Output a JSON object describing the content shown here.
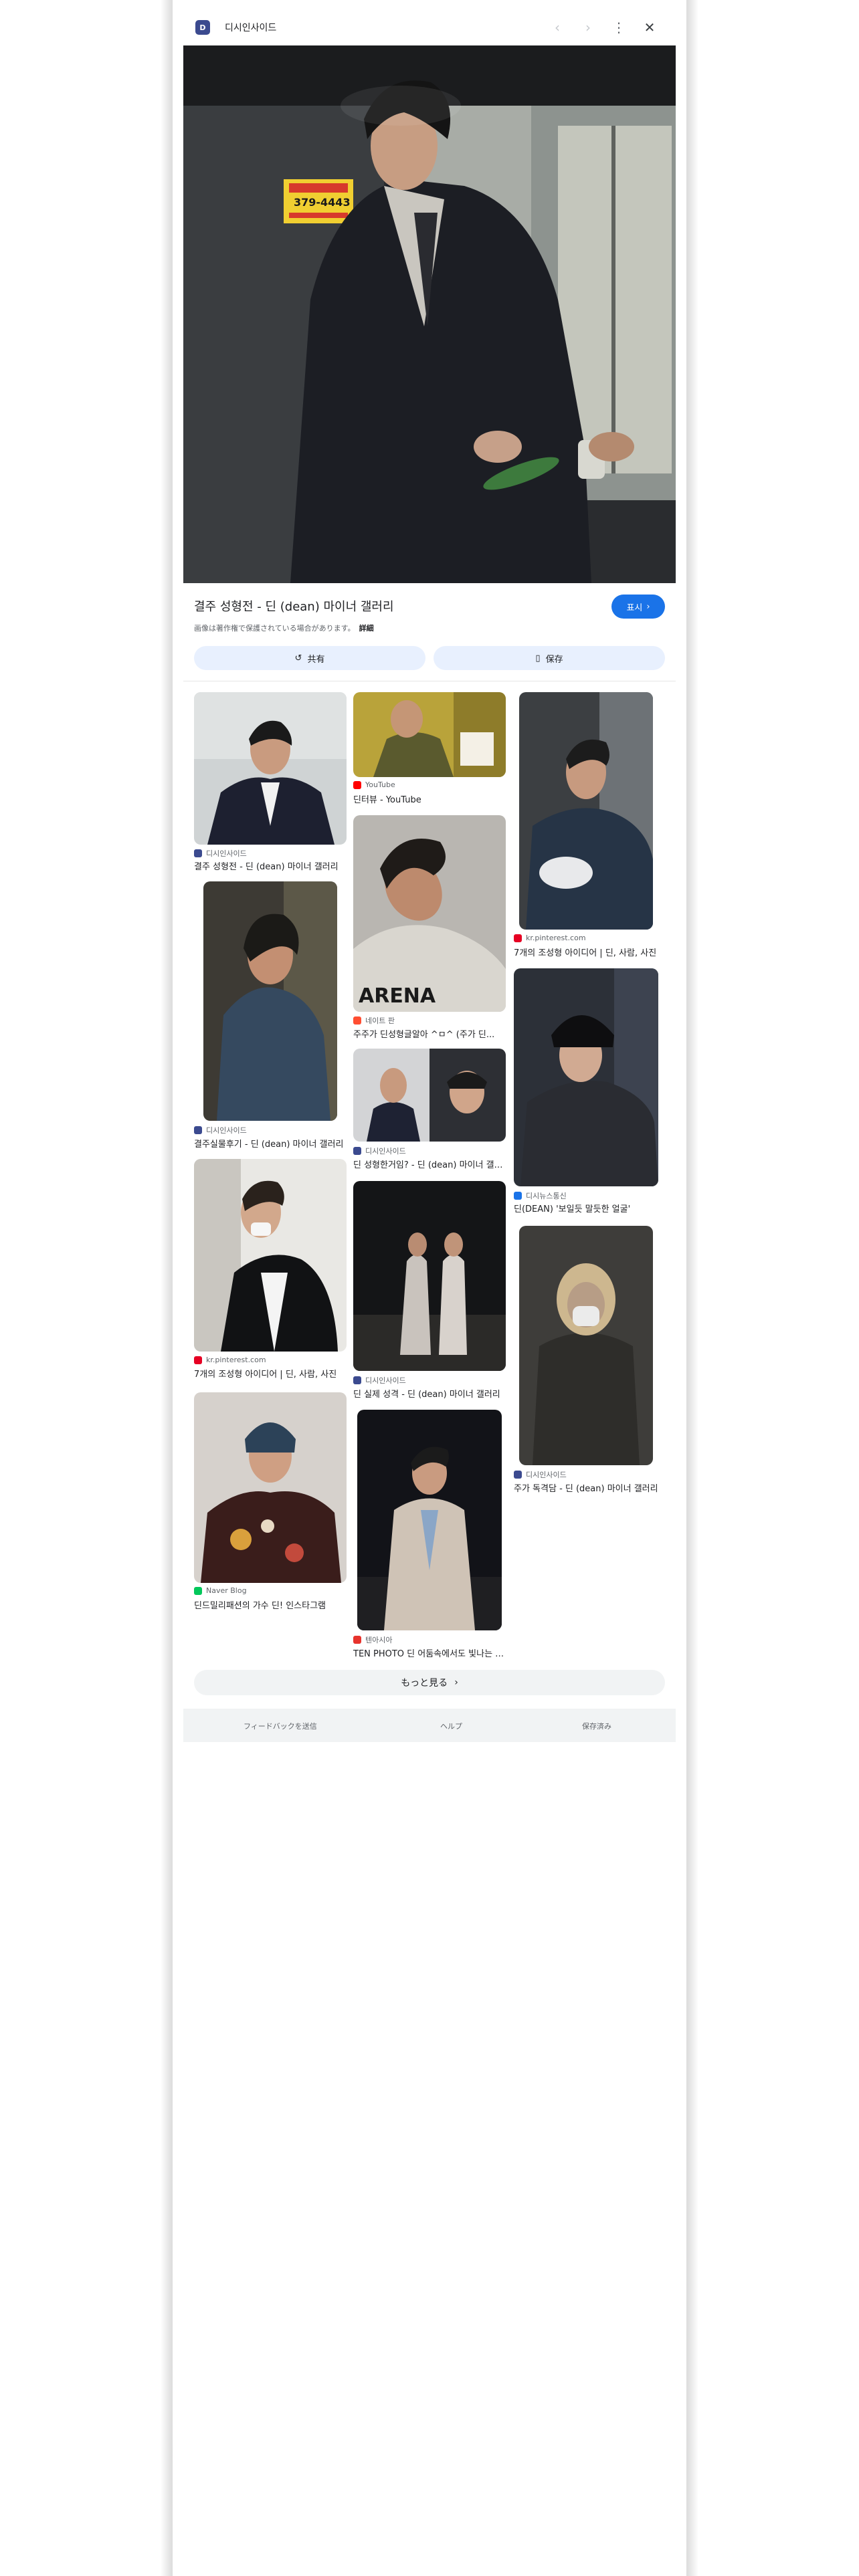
{
  "header": {
    "site_name": "디시인사이드",
    "site_logo_text": "D"
  },
  "hero": {
    "title": "결주 성형전 - 딘 (dean) 마이너 갤러리",
    "show_label": "표시",
    "copyright_text": "画像は著作権で保護されている場合があります。",
    "copyright_link": "詳細",
    "share_label": "共有",
    "save_label": "保存",
    "sign_phone": "379-4443"
  },
  "results": [
    {
      "source": "디시인사이드",
      "caption": "결주 성형전 - 딘 (dean) 마이너 갤러리",
      "favicon_color": "#3b4a8f"
    },
    {
      "source": "디시인사이드",
      "caption": "결주실물후기 - 딘 (dean) 마이너 갤러리",
      "favicon_color": "#3b4a8f"
    },
    {
      "source": "kr.pinterest.com",
      "caption": "7개의 조성형 아이디어 | 딘, 사람, 사진",
      "favicon_color": "#e60023"
    },
    {
      "source": "Naver Blog",
      "caption": "딘드밀리패션의 가수 딘! 인스타그램",
      "favicon_color": "#03c75a"
    },
    {
      "source": "YouTube",
      "caption": "딘터뷰 - YouTube",
      "favicon_color": "#ff0000"
    },
    {
      "source": "네이트 판",
      "caption": "주주가 딘성형글알아 ^ㅁ^ (주가 딘...",
      "favicon_color": "#ff4e32"
    },
    {
      "source": "디시인사이드",
      "caption": "딘 성형한거임? - 딘 (dean) 마이너 갤러리",
      "favicon_color": "#3b4a8f"
    },
    {
      "source": "디시인사이드",
      "caption": "딘 실제 성격 - 딘 (dean) 마이너 갤러리",
      "favicon_color": "#3b4a8f"
    },
    {
      "source": "텐아시아",
      "caption": "TEN PHOTO 딘 어둠속에서도 빛나는 비주얼",
      "favicon_color": "#e7332d"
    },
    {
      "source": "kr.pinterest.com",
      "caption": "7개의 조성형 아이디어 | 딘, 사람, 사진",
      "favicon_color": "#e60023"
    },
    {
      "source": "디시뉴스통신",
      "caption": "딘(DEAN) '보일듯 말듯한 얼굴'",
      "favicon_color": "#1a73e8"
    },
    {
      "source": "디시인사이드",
      "caption": "주가 독격담 - 딘 (dean) 마이너 갤러리",
      "favicon_color": "#3b4a8f"
    }
  ],
  "more_label": "もっと見る",
  "footer": {
    "feedback": "フィードバックを送信",
    "help": "ヘルプ",
    "saved": "保存済み"
  }
}
